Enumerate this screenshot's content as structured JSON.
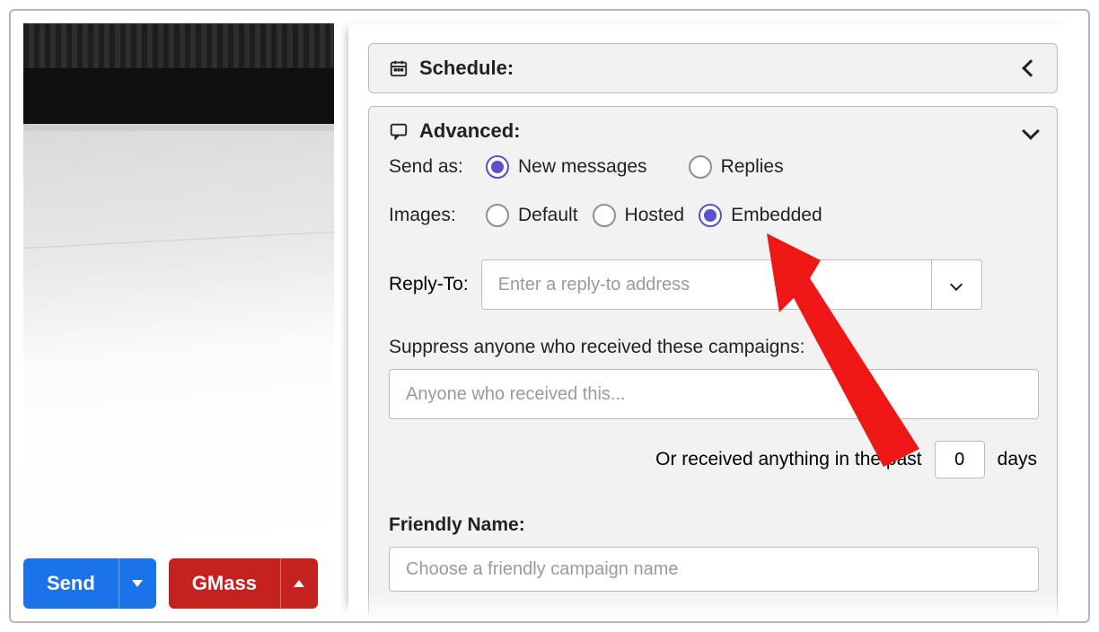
{
  "schedule": {
    "title": "Schedule:"
  },
  "advanced": {
    "title": "Advanced:",
    "send_as": {
      "label": "Send as:",
      "options": {
        "new_messages": "New messages",
        "replies": "Replies"
      },
      "selected": "new_messages"
    },
    "images": {
      "label": "Images:",
      "options": {
        "default": "Default",
        "hosted": "Hosted",
        "embedded": "Embedded"
      },
      "selected": "embedded"
    },
    "reply_to": {
      "label": "Reply-To:",
      "placeholder": "Enter a reply-to address",
      "value": ""
    },
    "suppress": {
      "label": "Suppress anyone who received these campaigns:",
      "placeholder": "Anyone who received this...",
      "value": ""
    },
    "past": {
      "prefix": "Or received anything in the past",
      "value": "0",
      "suffix": "days"
    },
    "friendly_name": {
      "label": "Friendly Name:",
      "placeholder": "Choose a friendly campaign name",
      "value": ""
    }
  },
  "buttons": {
    "send": "Send",
    "gmass": "GMass"
  },
  "colors": {
    "accent_purple": "#5b4ecf",
    "send_blue": "#1a73e8",
    "gmass_red": "#c5221f",
    "annotation_red": "#ef1616"
  }
}
